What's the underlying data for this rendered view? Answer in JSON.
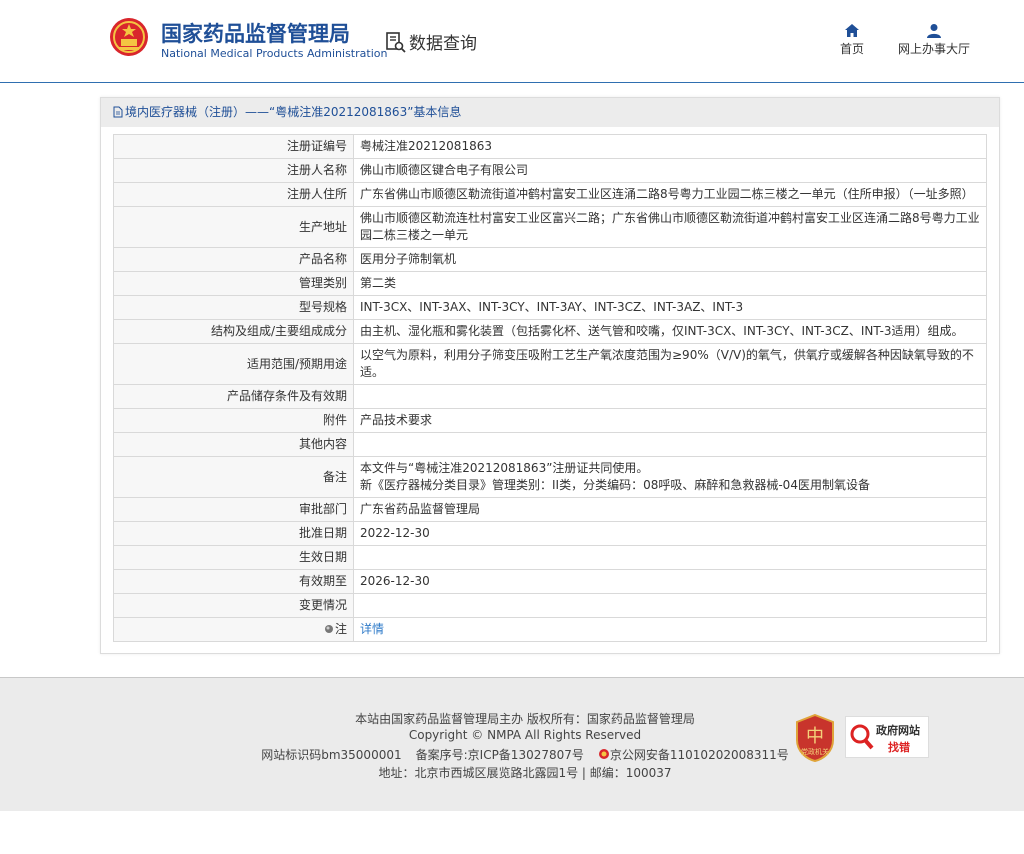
{
  "header": {
    "org_name_cn": "国家药品监督管理局",
    "org_name_en": "National Medical Products Administration",
    "query_label": "数据查询",
    "nav": {
      "home_label": "首页",
      "hall_label": "网上办事大厅"
    }
  },
  "panel": {
    "title": "境内医疗器械（注册）——“粤械注准20212081863”基本信息",
    "rows": [
      {
        "key": "注册证编号",
        "value": "粤械注准20212081863"
      },
      {
        "key": "注册人名称",
        "value": "佛山市顺德区键合电子有限公司"
      },
      {
        "key": "注册人住所",
        "value": "广东省佛山市顺德区勒流街道冲鹤村富安工业区连涌二路8号粤力工业园二栋三楼之一单元（住所申报）（一址多照）"
      },
      {
        "key": "生产地址",
        "value": "佛山市顺德区勒流连杜村富安工业区富兴二路；广东省佛山市顺德区勒流街道冲鹤村富安工业区连涌二路8号粤力工业园二栋三楼之一单元"
      },
      {
        "key": "产品名称",
        "value": "医用分子筛制氧机"
      },
      {
        "key": "管理类别",
        "value": "第二类"
      },
      {
        "key": "型号规格",
        "value": "INT-3CX、INT-3AX、INT-3CY、INT-3AY、INT-3CZ、INT-3AZ、INT-3"
      },
      {
        "key": "结构及组成/主要组成成分",
        "value": "由主机、湿化瓶和雾化装置（包括雾化杯、送气管和咬嘴，仅INT-3CX、INT-3CY、INT-3CZ、INT-3适用）组成。"
      },
      {
        "key": "适用范围/预期用途",
        "value": "以空气为原料，利用分子筛变压吸附工艺生产氧浓度范围为≥90%（V/V)的氧气，供氧疗或缓解各种因缺氧导致的不适。"
      },
      {
        "key": "产品储存条件及有效期",
        "value": ""
      },
      {
        "key": "附件",
        "value": "产品技术要求"
      },
      {
        "key": "其他内容",
        "value": ""
      },
      {
        "key": "备注",
        "value": "本文件与“粤械注准20212081863”注册证共同使用。\n新《医疗器械分类目录》管理类别：II类，分类编码：08呼吸、麻醉和急救器械-04医用制氧设备"
      },
      {
        "key": "审批部门",
        "value": "广东省药品监督管理局"
      },
      {
        "key": "批准日期",
        "value": "2022-12-30"
      },
      {
        "key": "生效日期",
        "value": ""
      },
      {
        "key": "有效期至",
        "value": "2026-12-30"
      },
      {
        "key": "变更情况",
        "value": ""
      }
    ],
    "note_row": {
      "key": "注",
      "link": "详情"
    }
  },
  "footer": {
    "line1": "本站由国家药品监督管理局主办 版权所有：国家药品监督管理局",
    "line2": "Copyright © NMPA All Rights Reserved",
    "site_id": "网站标识码bm35000001",
    "icp": "备案序号:京ICP备13027807号",
    "police": "京公网安备11010202008311号",
    "address": "地址：北京市西城区展览路北露园1号 | 邮编：100037",
    "badge1_text": "党政机关",
    "badge2_line1": "政府网站",
    "badge2_line2": "找错"
  },
  "colors": {
    "brand_blue": "#1f4f97",
    "link_blue": "#2f7bc9",
    "footer_bg": "#ebebeb"
  }
}
